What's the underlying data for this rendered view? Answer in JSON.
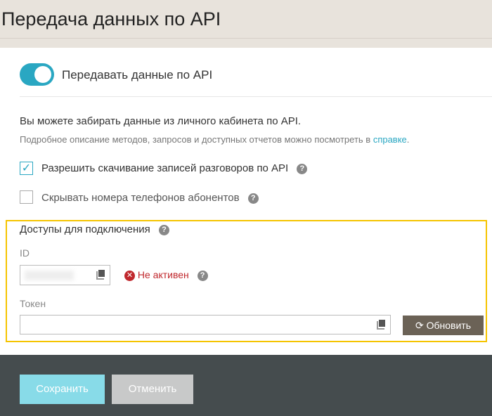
{
  "header": {
    "title": "Передача данных по API"
  },
  "toggle": {
    "label": "Передавать данные по API",
    "on": true
  },
  "info": {
    "line1": "Вы можете забирать данные из личного кабинета по API.",
    "line2_prefix": "Подробное описание методов, запросов и доступных отчетов можно посмотреть в ",
    "line2_link": "справке",
    "line2_suffix": "."
  },
  "options": [
    {
      "label": "Разрешить скачивание записей разговоров по API",
      "checked": true
    },
    {
      "label": "Скрывать номера телефонов абонентов",
      "checked": false
    }
  ],
  "access": {
    "heading": "Доступы для подключения",
    "id_label": "ID",
    "status": "Не активен",
    "token_label": "Токен",
    "token_value": "",
    "refresh_label": "Обновить"
  },
  "footer": {
    "save_label": "Сохранить",
    "cancel_label": "Отменить"
  },
  "colors": {
    "accent": "#2aa7c2",
    "highlight": "#f5c400",
    "error": "#c0282d",
    "footer": "#454c4e"
  }
}
